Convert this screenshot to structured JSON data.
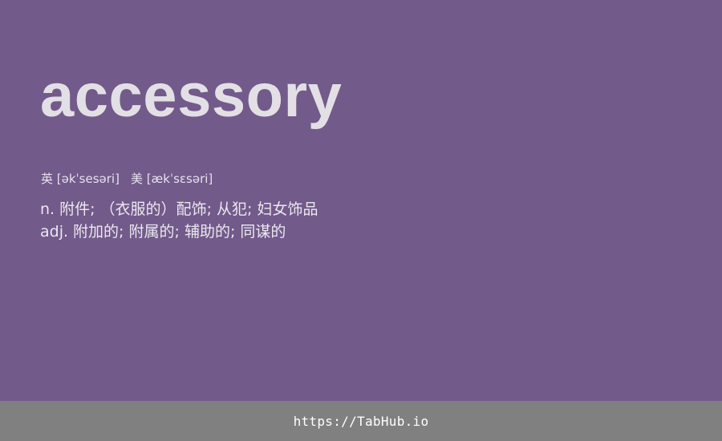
{
  "colors": {
    "background": "#725a8a",
    "footer_background": "#808080",
    "word_text": "#e2e0e5",
    "body_text": "#ebe8ef",
    "footer_text": "#ffffff"
  },
  "entry": {
    "word": "accessory",
    "phonetics": {
      "uk": "英 [əkˈsesəri]",
      "us": "美 [ækˈsɛsəri]"
    },
    "definitions": [
      "n. 附件; （衣服的）配饰; 从犯; 妇女饰品",
      "adj. 附加的; 附属的; 辅助的; 同谋的"
    ]
  },
  "footer": {
    "link_text": "https://TabHub.io"
  }
}
